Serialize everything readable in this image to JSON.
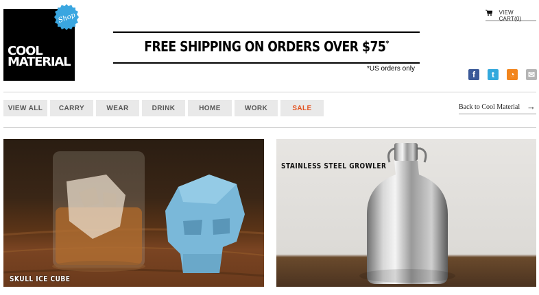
{
  "logo": {
    "line1": "COOL",
    "line2": "MATERIAL",
    "badge": "Shop",
    "badge_color": "#3aa6e0"
  },
  "cart": {
    "label": "VIEW CART(0)",
    "icon": "cart-icon"
  },
  "banner": {
    "text": "FREE SHIPPING ON ORDERS OVER $75",
    "mark": "*",
    "note": "*US orders only"
  },
  "social": [
    {
      "name": "facebook-icon",
      "glyph": "f",
      "color": "#3b5998"
    },
    {
      "name": "twitter-icon",
      "glyph": "t",
      "color": "#33a9dd"
    },
    {
      "name": "rss-icon",
      "glyph": "◔",
      "color": "#f2851d"
    },
    {
      "name": "mail-icon",
      "glyph": "✉",
      "color": "#b5b5b5"
    }
  ],
  "nav": {
    "items": [
      {
        "label": "VIEW ALL"
      },
      {
        "label": "CARRY"
      },
      {
        "label": "WEAR"
      },
      {
        "label": "DRINK"
      },
      {
        "label": "HOME"
      },
      {
        "label": "WORK"
      },
      {
        "label": "SALE",
        "accent": "#e3521f"
      }
    ],
    "back_link": "Back to Cool Material",
    "back_arrow": "→"
  },
  "products": [
    {
      "title": "SKULL ICE CUBE"
    },
    {
      "title": "STAINLESS STEEL GROWLER"
    }
  ]
}
